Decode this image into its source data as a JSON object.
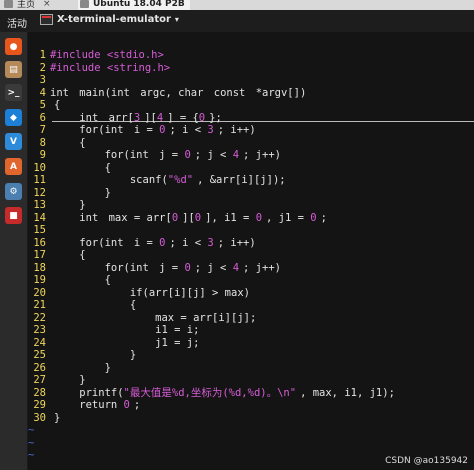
{
  "vm_tabs": {
    "home": "主页",
    "vm": "Ubuntu 18.04 P2B"
  },
  "topbar": {
    "activities": "活动",
    "app_title": "X-terminal-emulator",
    "caret": "▾"
  },
  "dock": [
    {
      "name": "firefox-icon",
      "color": "#e8561c",
      "glyph": "●"
    },
    {
      "name": "files-icon",
      "color": "#b48a5a",
      "glyph": "▤"
    },
    {
      "name": "terminal-icon",
      "color": "#3a3a3a",
      "glyph": ">_"
    },
    {
      "name": "vscode-icon",
      "color": "#1d7fd6",
      "glyph": "◆"
    },
    {
      "name": "vnote-icon",
      "color": "#2e8bd9",
      "glyph": "V"
    },
    {
      "name": "software-center-icon",
      "color": "#e0662e",
      "glyph": "A"
    },
    {
      "name": "settings-icon",
      "color": "#4a7fb0",
      "glyph": "⚙"
    },
    {
      "name": "app-icon",
      "color": "#c62b2b",
      "glyph": "■"
    }
  ],
  "code_lines": [
    {
      "n": "1",
      "t": [
        [
          "inc",
          "#include "
        ],
        [
          "str",
          "<stdio.h>"
        ]
      ]
    },
    {
      "n": "2",
      "t": [
        [
          "inc",
          "#include "
        ],
        [
          "str",
          "<string.h>"
        ]
      ]
    },
    {
      "n": "3",
      "t": []
    },
    {
      "n": "4",
      "t": [
        [
          "kw",
          "int"
        ],
        [
          "code",
          " main("
        ],
        [
          "kw",
          "int"
        ],
        [
          "code",
          " argc, "
        ],
        [
          "kw",
          "char"
        ],
        [
          "code",
          " "
        ],
        [
          "kw",
          "const"
        ],
        [
          "code",
          " *argv[])"
        ]
      ]
    },
    {
      "n": "5",
      "t": [
        [
          "code",
          "{"
        ]
      ]
    },
    {
      "n": "6",
      "t": [
        [
          "code",
          "    "
        ],
        [
          "kw",
          "int"
        ],
        [
          "code",
          " arr["
        ],
        [
          "num",
          "3"
        ],
        [
          "code",
          "]["
        ],
        [
          "num",
          "4"
        ],
        [
          "code",
          "] = {"
        ],
        [
          "num",
          "0"
        ],
        [
          "code",
          "};"
        ]
      ]
    },
    {
      "n": "7",
      "t": [
        [
          "code",
          "    for("
        ],
        [
          "kw",
          "int"
        ],
        [
          "code",
          " i = "
        ],
        [
          "num",
          "0"
        ],
        [
          "code",
          "; i < "
        ],
        [
          "num",
          "3"
        ],
        [
          "code",
          "; i++)"
        ]
      ]
    },
    {
      "n": "8",
      "t": [
        [
          "code",
          "    {"
        ]
      ]
    },
    {
      "n": "9",
      "t": [
        [
          "code",
          "        for("
        ],
        [
          "kw",
          "int"
        ],
        [
          "code",
          " j = "
        ],
        [
          "num",
          "0"
        ],
        [
          "code",
          "; j < "
        ],
        [
          "num",
          "4"
        ],
        [
          "code",
          "; j++)"
        ]
      ]
    },
    {
      "n": "10",
      "t": [
        [
          "code",
          "        {"
        ]
      ]
    },
    {
      "n": "11",
      "t": [
        [
          "code",
          "            scanf("
        ],
        [
          "str",
          "\"%d\""
        ],
        [
          "code",
          ", &arr[i][j]);"
        ]
      ]
    },
    {
      "n": "12",
      "t": [
        [
          "code",
          "        }"
        ]
      ]
    },
    {
      "n": "13",
      "t": [
        [
          "code",
          "    }"
        ]
      ]
    },
    {
      "n": "14",
      "t": [
        [
          "code",
          "    "
        ],
        [
          "kw",
          "int"
        ],
        [
          "code",
          " max = arr["
        ],
        [
          "num",
          "0"
        ],
        [
          "code",
          "]["
        ],
        [
          "num",
          "0"
        ],
        [
          "code",
          "], i1 = "
        ],
        [
          "num",
          "0"
        ],
        [
          "code",
          ", j1 = "
        ],
        [
          "num",
          "0"
        ],
        [
          "code",
          ";"
        ]
      ]
    },
    {
      "n": "15",
      "t": []
    },
    {
      "n": "16",
      "t": [
        [
          "code",
          "    for("
        ],
        [
          "kw",
          "int"
        ],
        [
          "code",
          " i = "
        ],
        [
          "num",
          "0"
        ],
        [
          "code",
          "; i < "
        ],
        [
          "num",
          "3"
        ],
        [
          "code",
          "; i++)"
        ]
      ]
    },
    {
      "n": "17",
      "t": [
        [
          "code",
          "    {"
        ]
      ]
    },
    {
      "n": "18",
      "t": [
        [
          "code",
          "        for("
        ],
        [
          "kw",
          "int"
        ],
        [
          "code",
          " j = "
        ],
        [
          "num",
          "0"
        ],
        [
          "code",
          "; j < "
        ],
        [
          "num",
          "4"
        ],
        [
          "code",
          "; j++)"
        ]
      ]
    },
    {
      "n": "19",
      "t": [
        [
          "code",
          "        {"
        ]
      ]
    },
    {
      "n": "20",
      "t": [
        [
          "code",
          "            if(arr[i][j] > max)"
        ]
      ]
    },
    {
      "n": "21",
      "t": [
        [
          "code",
          "            {"
        ]
      ]
    },
    {
      "n": "22",
      "t": [
        [
          "code",
          "                max = arr[i][j];"
        ]
      ]
    },
    {
      "n": "23",
      "t": [
        [
          "code",
          "                i1 = i;"
        ]
      ]
    },
    {
      "n": "24",
      "t": [
        [
          "code",
          "                j1 = j;"
        ]
      ]
    },
    {
      "n": "25",
      "t": [
        [
          "code",
          "            }"
        ]
      ]
    },
    {
      "n": "26",
      "t": [
        [
          "code",
          "        }"
        ]
      ]
    },
    {
      "n": "27",
      "t": [
        [
          "code",
          "    }"
        ]
      ]
    },
    {
      "n": "28",
      "t": [
        [
          "code",
          "    printf("
        ],
        [
          "str",
          "\"最大值是%d,坐标为(%d,%d)。\\n\""
        ],
        [
          "code",
          ", max, i1, j1);"
        ]
      ]
    },
    {
      "n": "29",
      "t": [
        [
          "code",
          "    return "
        ],
        [
          "num",
          "0"
        ],
        [
          "code",
          ";"
        ]
      ]
    },
    {
      "n": "30",
      "t": [
        [
          "code",
          "}"
        ]
      ]
    }
  ],
  "tilde_count": 3,
  "tilde_char": "~",
  "watermark": "CSDN @ao135942"
}
